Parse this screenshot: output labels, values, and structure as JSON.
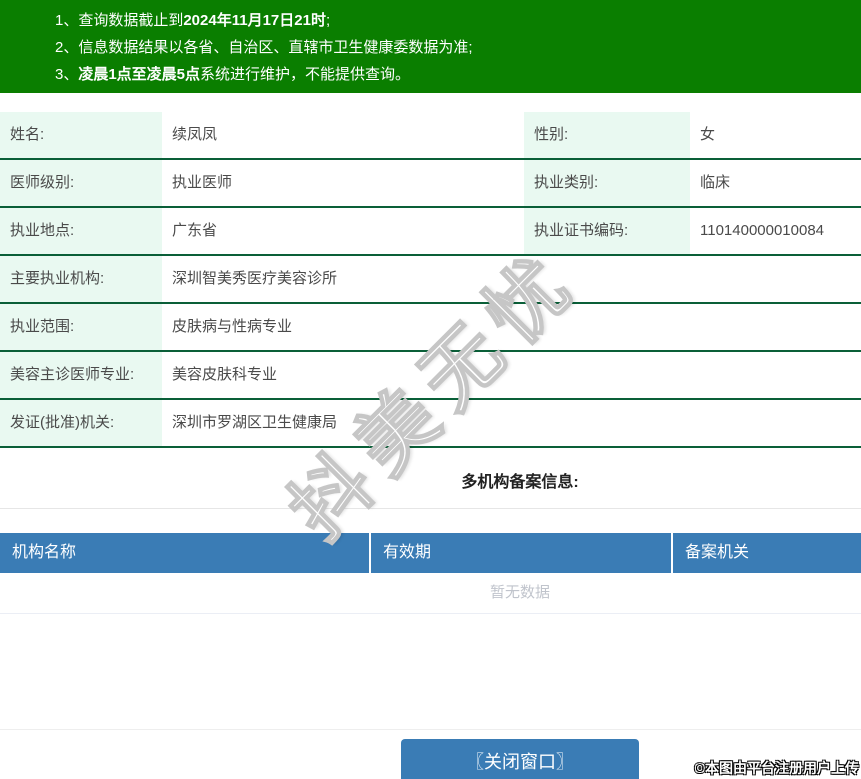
{
  "notices": {
    "items": [
      {
        "pre": "1、查询数据截止到",
        "bold": "2024年11月17日21时",
        "post": ";"
      },
      {
        "pre": "2、信息数据结果以各省、自治区、直辖市卫生健康委数据为准;",
        "bold": "",
        "post": ""
      },
      {
        "pre": "3、",
        "bold": "凌晨1点至凌晨5点",
        "post": "系统进行维护，不能提供查询。"
      }
    ]
  },
  "profile_rows": [
    {
      "label1": "姓名:",
      "value1": "续凤凤",
      "label2": "性别:",
      "value2": "女"
    },
    {
      "label1": "医师级别:",
      "value1": "执业医师",
      "label2": "执业类别:",
      "value2": "临床"
    },
    {
      "label1": "执业地点:",
      "value1": "广东省",
      "label2": "执业证书编码:",
      "value2": "110140000010084"
    },
    {
      "label1": "主要执业机构:",
      "value1": "深圳智美秀医疗美容诊所"
    },
    {
      "label1": "执业范围:",
      "value1": "皮肤病与性病专业"
    },
    {
      "label1": "美容主诊医师专业:",
      "value1": "美容皮肤科专业"
    },
    {
      "label1": "发证(批准)机关:",
      "value1": "深圳市罗湖区卫生健康局"
    }
  ],
  "multi_org": {
    "title": "多机构备案信息:",
    "columns": [
      "机构名称",
      "有效期",
      "备案机关"
    ],
    "empty_text": "暂无数据"
  },
  "footer": {
    "close_button": "〖关闭窗口〗",
    "credit": "©本图由平台注册用户上传"
  },
  "watermark_text": "抖美无忧",
  "colors": {
    "notice_bg": "#0a7e00",
    "row_border": "#0a5f38",
    "label_bg": "#e9f9f1",
    "table_header_bg": "#3a7cb5",
    "button_bg": "#3a7cb5",
    "empty_text": "#c0c4cc"
  }
}
